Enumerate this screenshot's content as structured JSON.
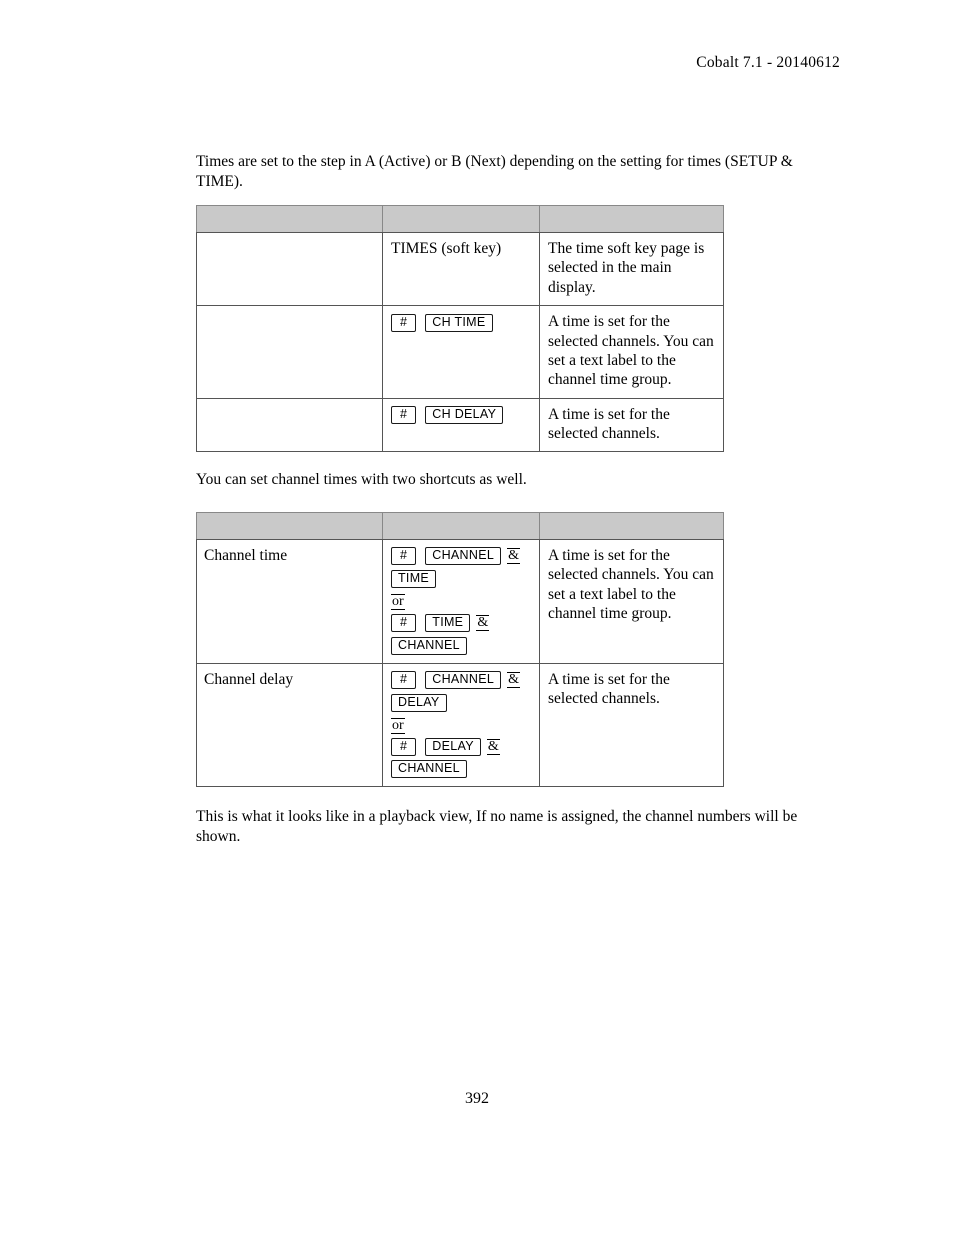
{
  "header": {
    "revision": "Cobalt 7.1 - 20140612"
  },
  "intro_paragraph": "Times are set to the step in A (Active) or B (Next) depending on the setting for times (SETUP & TIME).",
  "table1": {
    "header_cells": [
      "",
      "",
      ""
    ],
    "rows": [
      {
        "label": "",
        "keys": [
          {
            "type": "text",
            "text": "TIMES (soft key)"
          }
        ],
        "description": "The time soft key page is selected in the main display."
      },
      {
        "label": "",
        "keys": [
          {
            "type": "line",
            "items": [
              {
                "kind": "key",
                "label": "#"
              },
              {
                "kind": "sep"
              },
              {
                "kind": "key",
                "label": "CH TIME"
              }
            ]
          }
        ],
        "description": "A time is set for the selected channels. You can set a text label to the channel time group."
      },
      {
        "label": "",
        "keys": [
          {
            "type": "line",
            "items": [
              {
                "kind": "key",
                "label": "#"
              },
              {
                "kind": "sep"
              },
              {
                "kind": "key",
                "label": "CH DELAY"
              }
            ]
          }
        ],
        "description": "A time is set for the selected channels."
      }
    ]
  },
  "middle_paragraph": "You can set channel times with two shortcuts as well.",
  "table2": {
    "header_cells": [
      "",
      "",
      ""
    ],
    "rows": [
      {
        "label": "Channel time",
        "keys": [
          {
            "type": "line",
            "items": [
              {
                "kind": "key",
                "label": "#"
              },
              {
                "kind": "sep"
              },
              {
                "kind": "key",
                "label": "CHANNEL"
              },
              {
                "kind": "amp",
                "label": "&"
              }
            ]
          },
          {
            "type": "line",
            "items": [
              {
                "kind": "key",
                "label": "TIME"
              }
            ]
          },
          {
            "type": "or",
            "label": "or"
          },
          {
            "type": "line",
            "items": [
              {
                "kind": "key",
                "label": "#"
              },
              {
                "kind": "sep"
              },
              {
                "kind": "key",
                "label": "TIME"
              },
              {
                "kind": "amp",
                "label": "&"
              }
            ]
          },
          {
            "type": "line",
            "items": [
              {
                "kind": "key",
                "label": "CHANNEL"
              }
            ]
          }
        ],
        "description": "A time is set for the selected channels. You can set a text label to the channel time group."
      },
      {
        "label": "Channel delay",
        "keys": [
          {
            "type": "line",
            "items": [
              {
                "kind": "key",
                "label": "#"
              },
              {
                "kind": "sep"
              },
              {
                "kind": "key",
                "label": "CHANNEL"
              },
              {
                "kind": "amp",
                "label": "&"
              }
            ]
          },
          {
            "type": "line",
            "items": [
              {
                "kind": "key",
                "label": "DELAY"
              }
            ]
          },
          {
            "type": "or",
            "label": "or"
          },
          {
            "type": "line",
            "items": [
              {
                "kind": "key",
                "label": "#"
              },
              {
                "kind": "sep"
              },
              {
                "kind": "key",
                "label": "DELAY"
              },
              {
                "kind": "amp",
                "label": "&"
              }
            ]
          },
          {
            "type": "line",
            "items": [
              {
                "kind": "key",
                "label": "CHANNEL"
              }
            ]
          }
        ],
        "description": "A time is set for the selected channels."
      }
    ]
  },
  "closing_paragraph": "This is what it looks like in a playback view, If no name is assigned, the channel numbers will be shown.",
  "page_number": "392",
  "colors": {
    "table_header_fill": "#c9c9c9",
    "table_outer_border": "#888888",
    "table_inner_border": "#555555",
    "text": "#000000"
  }
}
